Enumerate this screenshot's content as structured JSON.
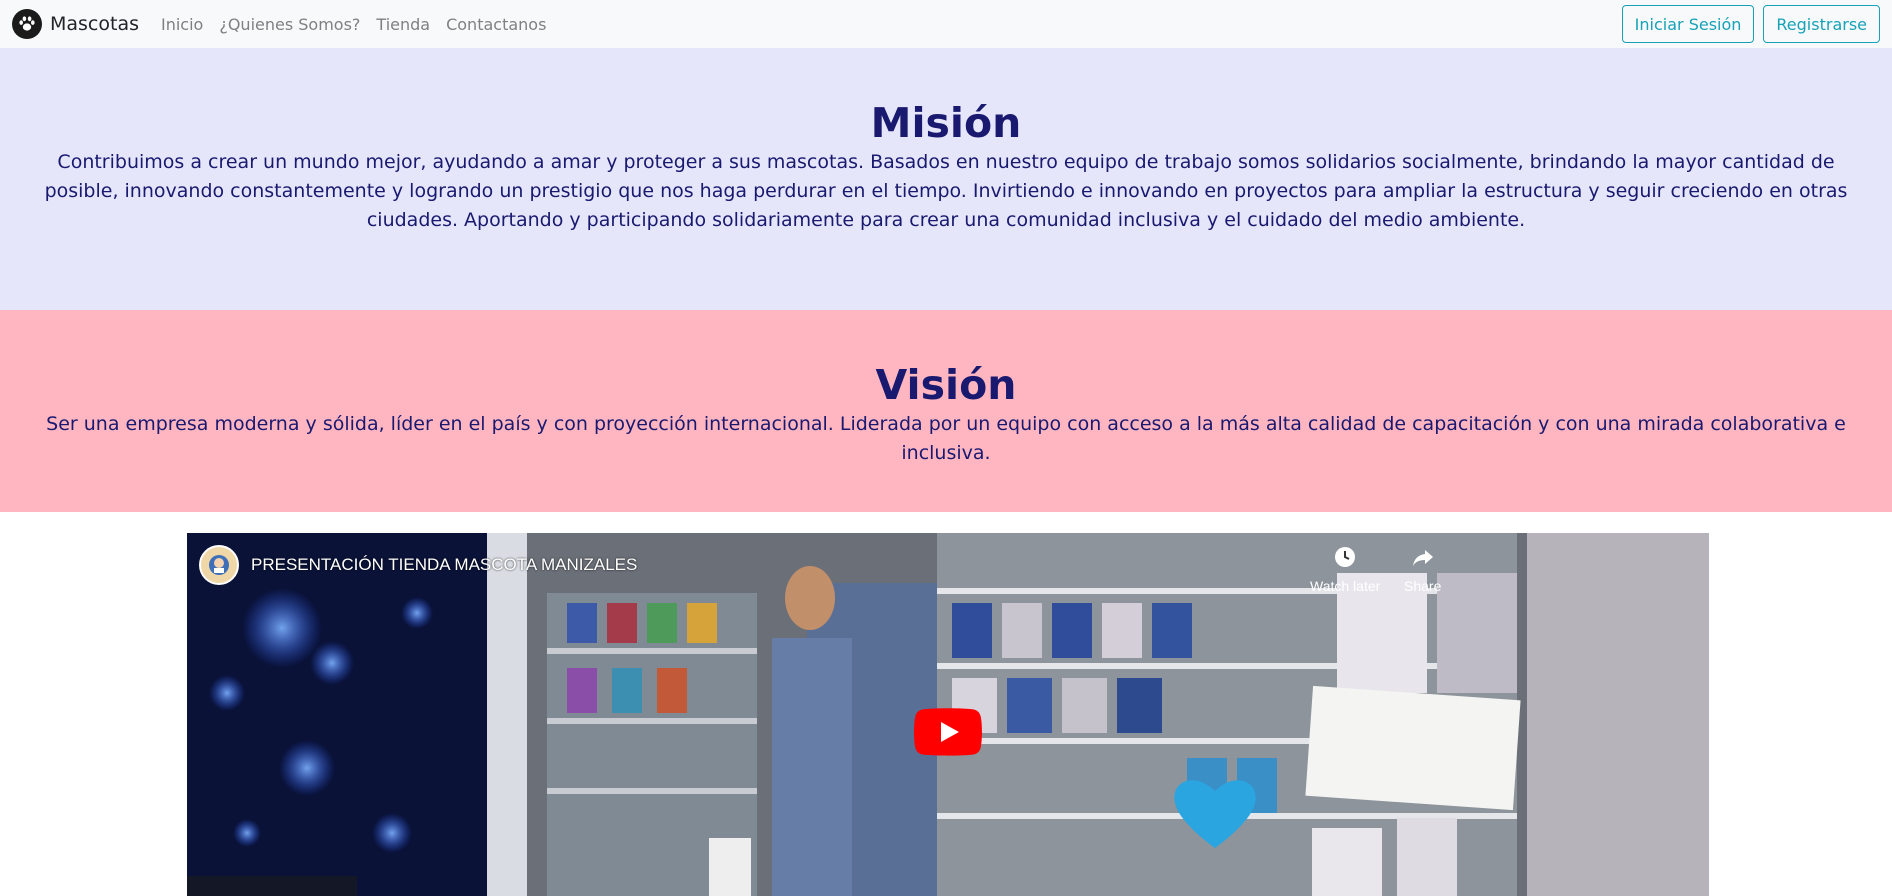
{
  "navbar": {
    "brand": "Mascotas",
    "links": [
      "Inicio",
      "¿Quienes Somos?",
      "Tienda",
      "Contactanos"
    ],
    "login_label": "Iniciar Sesión",
    "register_label": "Registrarse"
  },
  "mision": {
    "title": "Misión",
    "text": "Contribuimos a crear un mundo mejor, ayudando a amar y proteger a sus mascotas. Basados en nuestro equipo de trabajo somos solidarios socialmente, brindando la mayor cantidad de posible, innovando constantemente y logrando un prestigio que nos haga perdurar en el tiempo. Invirtiendo e innovando en proyectos para ampliar la estructura y seguir creciendo en otras ciudades. Aportando y participando solidariamente para crear una comunidad inclusiva y el cuidado del medio ambiente."
  },
  "vision": {
    "title": "Visión",
    "text": "Ser una empresa moderna y sólida, líder en el país y con proyección internacional. Liderada por un equipo con acceso a la más alta calidad de capacitación y con una mirada colaborativa e inclusiva."
  },
  "video": {
    "title": "PRESENTACIÓN TIENDA MASCOTA MANIZALES",
    "watch_later": "Watch later",
    "share": "Share"
  },
  "colors": {
    "accent": "#17a2b8",
    "mision_bg": "#e6e6fa",
    "vision_bg": "#ffb6c1",
    "heading": "#191970"
  }
}
